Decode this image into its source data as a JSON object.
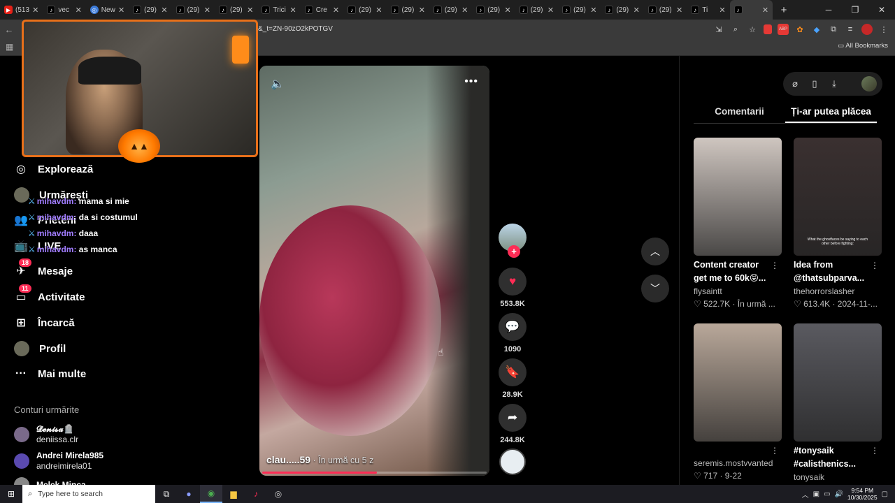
{
  "browser": {
    "tabs": [
      {
        "icon": "youtube-icon",
        "title": "(513"
      },
      {
        "icon": "tiktok-icon",
        "title": "vec"
      },
      {
        "icon": "chrome-icon",
        "title": "New"
      },
      {
        "icon": "tiktok-icon",
        "title": "(29)"
      },
      {
        "icon": "tiktok-icon",
        "title": "(29)"
      },
      {
        "icon": "tiktok-icon",
        "title": "(29)"
      },
      {
        "icon": "tiktok-icon",
        "title": "Trici"
      },
      {
        "icon": "tiktok-icon",
        "title": "Cre"
      },
      {
        "icon": "tiktok-icon",
        "title": "(29)"
      },
      {
        "icon": "tiktok-icon",
        "title": "(29)"
      },
      {
        "icon": "tiktok-icon",
        "title": "(29)"
      },
      {
        "icon": "tiktok-icon",
        "title": "(29)"
      },
      {
        "icon": "tiktok-icon",
        "title": "(29)"
      },
      {
        "icon": "tiktok-icon",
        "title": "(29)"
      },
      {
        "icon": "tiktok-icon",
        "title": "(29)"
      },
      {
        "icon": "tiktok-icon",
        "title": "(29)"
      },
      {
        "icon": "tiktok-icon",
        "title": "Ti"
      },
      {
        "icon": "tiktok-icon",
        "title": "",
        "active": true
      }
    ],
    "new_tab": "+",
    "url": "&_t=ZN-90zO2kPOTGV",
    "all_bookmarks": "All Bookmarks"
  },
  "sidebar": {
    "nav": [
      {
        "label": "Explorează",
        "icon": "compass-icon"
      },
      {
        "label": "Urmărești",
        "icon": "following-avatar-icon"
      },
      {
        "label": "Prieteni",
        "icon": "friends-icon"
      },
      {
        "label": "LIVE",
        "icon": "live-tv-icon"
      },
      {
        "label": "Mesaje",
        "icon": "messages-icon",
        "badge": "18"
      },
      {
        "label": "Activitate",
        "icon": "activity-icon",
        "badge": "11"
      },
      {
        "label": "Încarcă",
        "icon": "upload-icon"
      },
      {
        "label": "Profil",
        "icon": "profile-avatar-icon"
      },
      {
        "label": "Mai multe",
        "icon": "more-dots-icon"
      }
    ],
    "following_title": "Conturi urmărite",
    "following": [
      {
        "name": "𝓓𝓮𝓷𝓲𝓼𝓪🪦",
        "handle": "deniissa.clr"
      },
      {
        "name": "Andrei Mirela985",
        "handle": "andreimirela01"
      },
      {
        "name": "Melek Minca",
        "handle": ""
      }
    ]
  },
  "chat": [
    {
      "user": "mihavdm:",
      "text": "mama si mie"
    },
    {
      "user": "mihavdm:",
      "text": "da si costumul"
    },
    {
      "user": "mihavdm:",
      "text": "daaa"
    },
    {
      "user": "mihavdm:",
      "text": "as manca"
    }
  ],
  "video": {
    "author": "clau.....59",
    "time": " · În urmă cu 5 z",
    "progress": 0.51,
    "likes": "553.8K",
    "comments": "1090",
    "saves": "28.9K",
    "shares": "244.8K"
  },
  "right_panel": {
    "tabs": [
      "Comentarii",
      "Ți-ar putea plăcea"
    ],
    "active_tab": 1,
    "cards": [
      {
        "title": "Content creator get me to 60k😝...",
        "author": "flysaintt",
        "stats": "♡ 522.7K · În urmă ...",
        "thumb_color": "#cfc6c0"
      },
      {
        "title": "Idea from @thatsubparva...",
        "author": "thehorrorslasher",
        "stats": "♡ 613.4K · 2024-11-...",
        "thumb_color": "#3a3030",
        "caption": "What the ghostfaces be saying to each other before fighting:"
      },
      {
        "title": "",
        "author": "seremis.mostvvanted",
        "stats": "♡ 717 · 9-22",
        "thumb_color": "#b9a89a"
      },
      {
        "title": "#tonysaik #calisthenics...",
        "author": "tonysaik",
        "stats": "",
        "thumb_color": "#5a5a60"
      }
    ]
  },
  "taskbar": {
    "search_placeholder": "Type here to search",
    "time": "9:54 PM",
    "date": "10/30/2025"
  },
  "colors": {
    "accent": "#fe2c55",
    "webcam_border": "#e8701a",
    "chat_user": "#a07cff"
  }
}
